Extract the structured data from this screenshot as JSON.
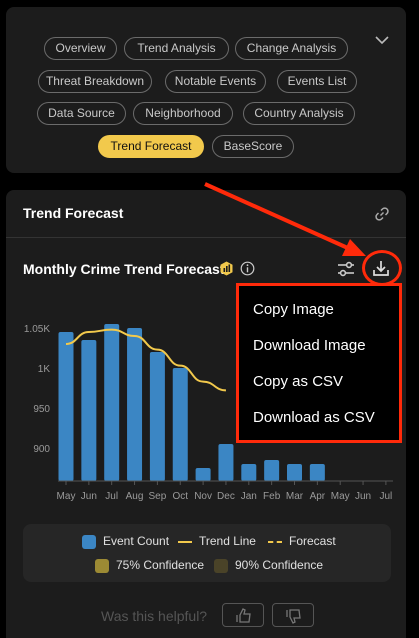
{
  "tabs": [
    {
      "label": "Overview",
      "active": false
    },
    {
      "label": "Trend Analysis",
      "active": false
    },
    {
      "label": "Change Analysis",
      "active": false
    },
    {
      "label": "Threat Breakdown",
      "active": false
    },
    {
      "label": "Notable Events",
      "active": false
    },
    {
      "label": "Events List",
      "active": false
    },
    {
      "label": "Data Source",
      "active": false
    },
    {
      "label": "Neighborhood",
      "active": false
    },
    {
      "label": "Country Analysis",
      "active": false
    },
    {
      "label": "Trend Forecast",
      "active": true
    },
    {
      "label": "BaseScore",
      "active": false
    }
  ],
  "section": {
    "title": "Trend Forecast"
  },
  "chart_header": {
    "title": "Monthly Crime Trend Forecast"
  },
  "export_menu": {
    "items": [
      "Copy Image",
      "Download Image",
      "Copy as CSV",
      "Download as CSV"
    ]
  },
  "legend": {
    "event_count": "Event Count",
    "trend_line": "Trend Line",
    "forecast": "Forecast",
    "conf75": "75% Confidence",
    "conf90": "90% Confidence"
  },
  "feedback": {
    "prompt": "Was this helpful?"
  },
  "colors": {
    "accent": "#f2c94c",
    "bar": "#3b86c4",
    "trend": "#f2c94c",
    "annotation": "#ff2a0a",
    "conf75": "#9c8a34",
    "conf90": "#4a4328"
  },
  "chart_data": {
    "type": "bar",
    "categories": [
      "May",
      "Jun",
      "Jul",
      "Aug",
      "Sep",
      "Oct",
      "Nov",
      "Dec",
      "Jan",
      "Feb",
      "Mar",
      "Apr",
      "May",
      "Jun",
      "Jul"
    ],
    "y_ticks": [
      "1.05K",
      "1K",
      "950",
      "900"
    ],
    "ylim": [
      860,
      1065
    ],
    "series": [
      {
        "name": "Event Count",
        "type": "bar",
        "values": [
          1045,
          1035,
          1055,
          1050,
          1020,
          1000,
          875,
          905,
          880,
          885,
          880,
          880,
          null,
          null,
          null
        ]
      },
      {
        "name": "Trend Line",
        "type": "line",
        "values": [
          1030,
          1045,
          1048,
          1040,
          1023,
          1003,
          983,
          972,
          null,
          null,
          null,
          null,
          null,
          null,
          null
        ]
      }
    ]
  }
}
